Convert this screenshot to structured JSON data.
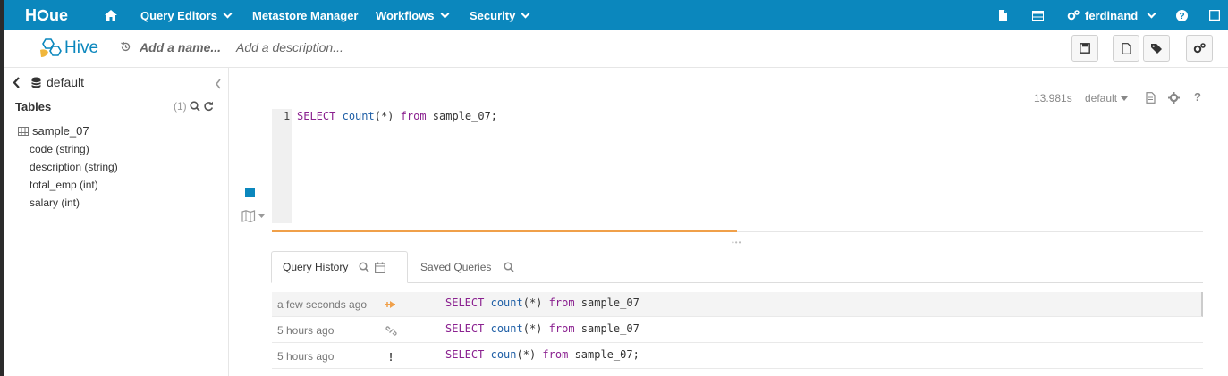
{
  "nav": {
    "logo_text": "HUE",
    "query_editors": "Query Editors",
    "metastore": "Metastore Manager",
    "workflows": "Workflows",
    "security": "Security",
    "user": "ferdinand",
    "icons": [
      "home-icon",
      "document-icon",
      "table-icon",
      "gears-icon",
      "help-icon",
      "checkbox-icon"
    ]
  },
  "editor": {
    "type_label": "Hive",
    "name_placeholder": "Add a name...",
    "description_placeholder": "Add a description...",
    "toolbar_icons": [
      "save-icon",
      "new-document-icon",
      "tags-icon",
      "settings-icon"
    ],
    "execution_time": "13.981s",
    "database": "default",
    "line_number": "1",
    "query": {
      "kw1": "SELECT",
      "fn": "count",
      "args": "(*)",
      "kw2": "from",
      "table": "sample_07;"
    }
  },
  "assist": {
    "database": "default",
    "tables_heading": "Tables",
    "tables_count": "(1)",
    "table": "sample_07",
    "columns": [
      "code (string)",
      "description (string)",
      "total_emp (int)",
      "salary (int)"
    ]
  },
  "tabs": {
    "history": "Query History",
    "saved": "Saved Queries"
  },
  "history": [
    {
      "time": "a few seconds ago",
      "status": "running",
      "kw1": "SELECT",
      "fn": "count",
      "args": "(*)",
      "kw2": "from",
      "table": "sample_07"
    },
    {
      "time": "5 hours ago",
      "status": "success",
      "kw1": "SELECT",
      "fn": "count",
      "args": "(*)",
      "kw2": "from",
      "table": "sample_07"
    },
    {
      "time": "5 hours ago",
      "status": "failed",
      "kw1": "SELECT",
      "fn": "coun",
      "args": "(*)",
      "kw2": "from",
      "table": "sample_07;"
    }
  ],
  "colors": {
    "brand": "#0b87bd",
    "progress": "#f0a04a",
    "keyword": "#8b2290",
    "function": "#1f5fa6"
  }
}
